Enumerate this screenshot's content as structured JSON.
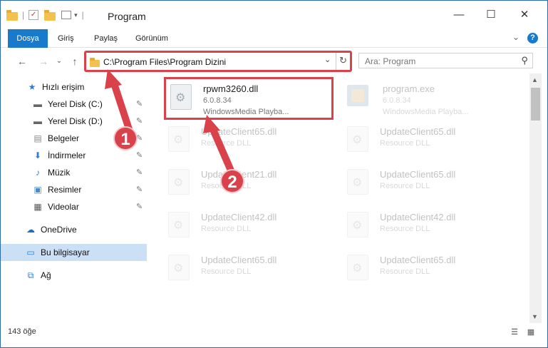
{
  "window": {
    "title": "Program",
    "minimize": "—",
    "maximize": "☐",
    "close": "✕"
  },
  "ribbon": {
    "tabs": [
      "Dosya",
      "Giriş",
      "Paylaş",
      "Görünüm"
    ],
    "collapse": "⌄",
    "help": "?"
  },
  "nav": {
    "back": "←",
    "forward": "→",
    "recent": "⌄",
    "up": "↑",
    "address_path": "C:\\Program Files\\Program Dizini",
    "address_dropdown": "⌄",
    "refresh": "↻",
    "search_placeholder": "Ara: Program",
    "search_icon": "⚲"
  },
  "sidebar": {
    "items": [
      {
        "label": "Hızlı erişim",
        "icon": "star-icon",
        "glyph": "★"
      },
      {
        "label": "Yerel Disk (C:)",
        "icon": "drive-icon",
        "glyph": "▬"
      },
      {
        "label": "Yerel Disk (D:)",
        "icon": "drive-icon",
        "glyph": "▬"
      },
      {
        "label": "Belgeler",
        "icon": "documents-icon",
        "glyph": "▤"
      },
      {
        "label": "İndirmeler",
        "icon": "download-icon",
        "glyph": "⬇"
      },
      {
        "label": "Müzik",
        "icon": "music-icon",
        "glyph": "♪"
      },
      {
        "label": "Resimler",
        "icon": "pictures-icon",
        "glyph": "▣"
      },
      {
        "label": "Videolar",
        "icon": "videos-icon",
        "glyph": "▦"
      },
      {
        "label": "OneDrive",
        "icon": "cloud-icon",
        "glyph": "☁"
      },
      {
        "label": "Bu bilgisayar",
        "icon": "computer-icon",
        "glyph": "▭"
      },
      {
        "label": "Ağ",
        "icon": "network-icon",
        "glyph": "⧉"
      }
    ],
    "pin_glyph": "✎"
  },
  "files": {
    "highlighted": {
      "name": "rpwm3260.dll",
      "version": "6.0.8.34",
      "description": "WindowsMedia Playba..."
    },
    "program_exe": {
      "name": "program.exe",
      "version": "6.0.8.34",
      "description": "WindowsMedia Playba..."
    },
    "list": [
      {
        "name": "UpdateClient65.dll",
        "type": "Resource DLL"
      },
      {
        "name": "UpdateClient65.dll",
        "type": "Resource DLL"
      },
      {
        "name": "UpdateClient21.dll",
        "type": "Resource DLL"
      },
      {
        "name": "UpdateClient65.dll",
        "type": "Resource DLL"
      },
      {
        "name": "UpdateClient42.dll",
        "type": "Resource DLL"
      },
      {
        "name": "UpdateClient42.dll",
        "type": "Resource DLL"
      },
      {
        "name": "UpdateClient65.dll",
        "type": "Resource DLL"
      },
      {
        "name": "UpdateClient65.dll",
        "type": "Resource DLL"
      }
    ]
  },
  "status": {
    "item_count": "143 öğe",
    "details_view": "☰",
    "large_icons_view": "▦"
  },
  "annotations": {
    "step1": "1",
    "step2": "2",
    "color": "#d9424b"
  }
}
